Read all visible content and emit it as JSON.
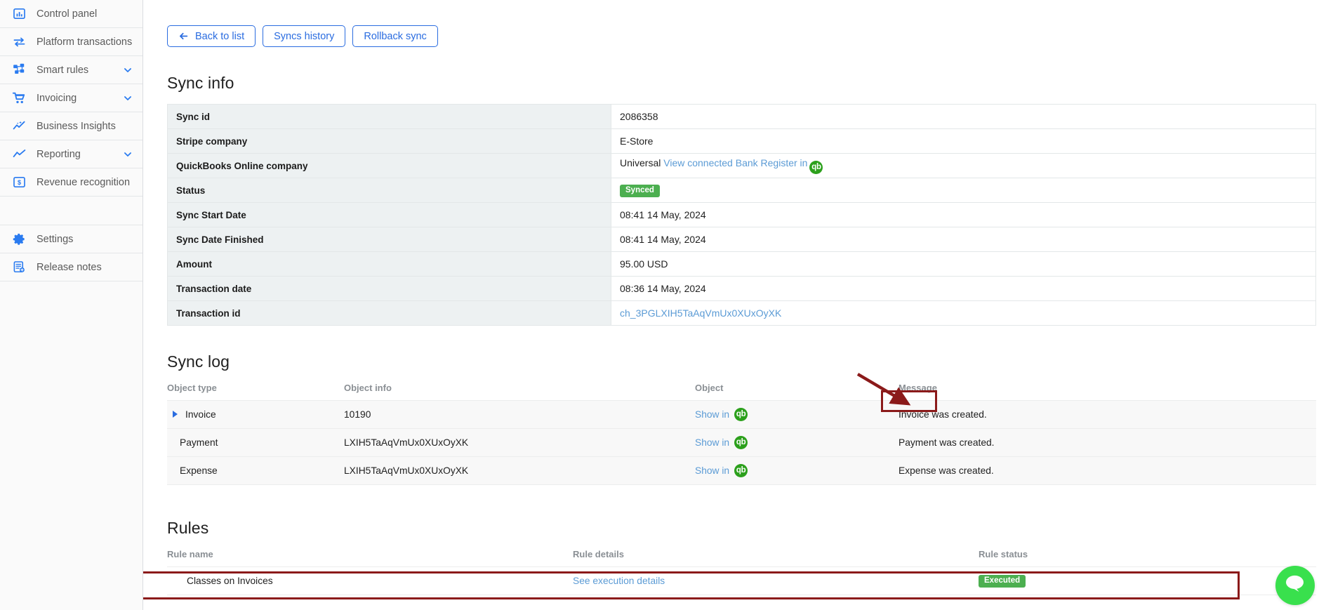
{
  "sidebar": {
    "items": [
      {
        "label": "Control panel",
        "icon": "chart-bar-icon",
        "expandable": false
      },
      {
        "label": "Platform transactions",
        "icon": "transfer-arrows-icon",
        "expandable": false
      },
      {
        "label": "Smart rules",
        "icon": "sitemap-icon",
        "expandable": true
      },
      {
        "label": "Invoicing",
        "icon": "shopping-cart-icon",
        "expandable": true
      },
      {
        "label": "Business Insights",
        "icon": "insights-sparkline-icon",
        "expandable": false
      },
      {
        "label": "Reporting",
        "icon": "line-chart-icon",
        "expandable": true
      },
      {
        "label": "Revenue recognition",
        "icon": "dollar-square-icon",
        "expandable": false
      }
    ],
    "footer_items": [
      {
        "label": "Settings",
        "icon": "gear-icon"
      },
      {
        "label": "Release notes",
        "icon": "document-plus-icon"
      }
    ]
  },
  "toolbar": {
    "back_label": "Back to list",
    "back_icon": "arrow-left-icon",
    "syncs_history_label": "Syncs history",
    "rollback_label": "Rollback sync"
  },
  "sync_info": {
    "title": "Sync info",
    "rows": [
      {
        "key": "Sync id",
        "value": "2086358",
        "type": "text"
      },
      {
        "key": "Stripe company",
        "value": "E-Store",
        "type": "text"
      },
      {
        "key": "QuickBooks Online company",
        "value": "Universal",
        "link_text": "View connected Bank Register in",
        "icon": "quickbooks-icon",
        "type": "link-with-icon"
      },
      {
        "key": "Status",
        "value": "Synced",
        "type": "badge"
      },
      {
        "key": "Sync Start Date",
        "value": "08:41 14 May, 2024",
        "type": "text"
      },
      {
        "key": "Sync Date Finished",
        "value": "08:41 14 May, 2024",
        "type": "text"
      },
      {
        "key": "Amount",
        "value": "95.00 USD",
        "type": "text"
      },
      {
        "key": "Transaction date",
        "value": "08:36 14 May, 2024",
        "type": "text"
      },
      {
        "key": "Transaction id",
        "value": "ch_3PGLXIH5TaAqVmUx0XUxOyXK",
        "type": "link"
      }
    ]
  },
  "sync_log": {
    "title": "Sync log",
    "columns": [
      "Object type",
      "Object info",
      "Object",
      "Message"
    ],
    "rows": [
      {
        "object_type": "Invoice",
        "object_info": "10190",
        "object_link": "Show in",
        "object_icon": "quickbooks-icon",
        "message": "Invoice was created.",
        "expandable": true,
        "highlighted": true
      },
      {
        "object_type": "Payment",
        "object_info": "LXIH5TaAqVmUx0XUxOyXK",
        "object_link": "Show in",
        "object_icon": "quickbooks-icon",
        "message": "Payment was created.",
        "expandable": false,
        "highlighted": false
      },
      {
        "object_type": "Expense",
        "object_info": "LXIH5TaAqVmUx0XUxOyXK",
        "object_link": "Show in",
        "object_icon": "quickbooks-icon",
        "message": "Expense was created.",
        "expandable": false,
        "highlighted": false
      }
    ]
  },
  "rules": {
    "title": "Rules",
    "columns": [
      "Rule name",
      "Rule details",
      "Rule status"
    ],
    "rows": [
      {
        "rule_name": "Classes on Invoices",
        "rule_details": "See execution details",
        "rule_status": "Executed",
        "highlighted": true
      }
    ]
  },
  "annotations": {
    "arrow_color": "#8b1a1a",
    "highlight_color": "#8b1a1a",
    "arrow_target": "show-in-quickbooks-link"
  },
  "chat_widget": {
    "icon": "chat-bubble-icon",
    "color": "#39e04d"
  },
  "colors": {
    "accent_blue": "#2a6ce0",
    "link_blue": "#5b9bd5",
    "status_green": "#4caf50",
    "quickbooks_green": "#2ca01c",
    "table_key_bg": "#edf1f2"
  }
}
